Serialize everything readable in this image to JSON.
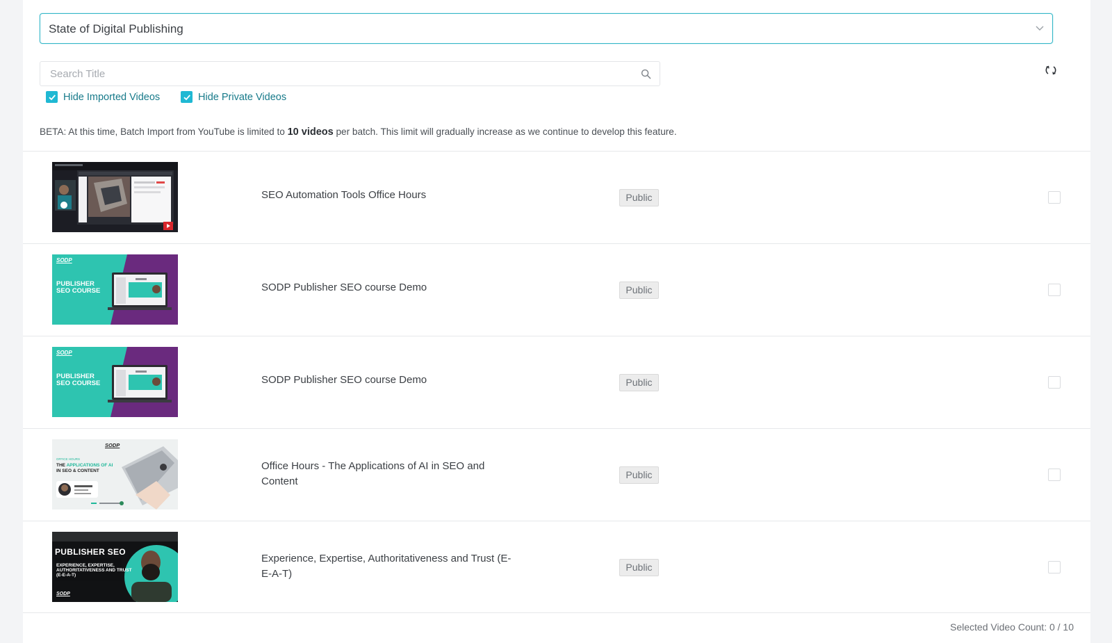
{
  "channel": {
    "selected": "State of Digital Publishing"
  },
  "search": {
    "placeholder": "Search Title"
  },
  "filters": {
    "hide_imported": {
      "label": "Hide Imported Videos",
      "checked": true
    },
    "hide_private": {
      "label": "Hide Private Videos",
      "checked": true
    }
  },
  "beta": {
    "prefix": "BETA: At this time, Batch Import from YouTube is limited to",
    "limit": "10 videos",
    "suffix": "per batch. This limit will gradually increase as we continue to develop this feature."
  },
  "videos": [
    {
      "title": "SEO Automation Tools Office Hours",
      "status": "Public",
      "selected": false
    },
    {
      "title": "SODP Publisher SEO course Demo",
      "status": "Public",
      "selected": false,
      "thumb_text": {
        "brand": "SODP",
        "headline": "PUBLISHER SEO COURSE"
      }
    },
    {
      "title": "SODP Publisher SEO course Demo",
      "status": "Public",
      "selected": false,
      "thumb_text": {
        "brand": "SODP",
        "headline": "PUBLISHER SEO COURSE"
      }
    },
    {
      "title": "Office Hours - The Applications of AI in SEO and Content",
      "status": "Public",
      "selected": false,
      "thumb_text": {
        "brand": "SODP",
        "kicker": "OFFICE HOURS",
        "headline_a": "THE ",
        "headline_b": "APPLICATIONS OF AI",
        "headline_c": "IN SEO & CONTENT"
      }
    },
    {
      "title": "Experience, Expertise, Authoritativeness and Trust (E-E-A-T)",
      "status": "Public",
      "selected": false,
      "thumb_text": {
        "brand": "SODP",
        "headline": "PUBLISHER SEO",
        "sub": "EXPERIENCE, EXPERTISE, AUTHORITATIVENESS AND TRUST (E-E-A-T)"
      }
    }
  ],
  "selection": {
    "label": "Selected Video Count: 0 / 10"
  },
  "colors": {
    "accent": "#1fb8d3",
    "teal_thumb": "#2ec4b0",
    "purple_thumb": "#6a2a7e"
  },
  "icons": {
    "select": "chevron-down-icon",
    "search": "search-icon",
    "refresh": "refresh-icon",
    "check": "check-icon"
  }
}
